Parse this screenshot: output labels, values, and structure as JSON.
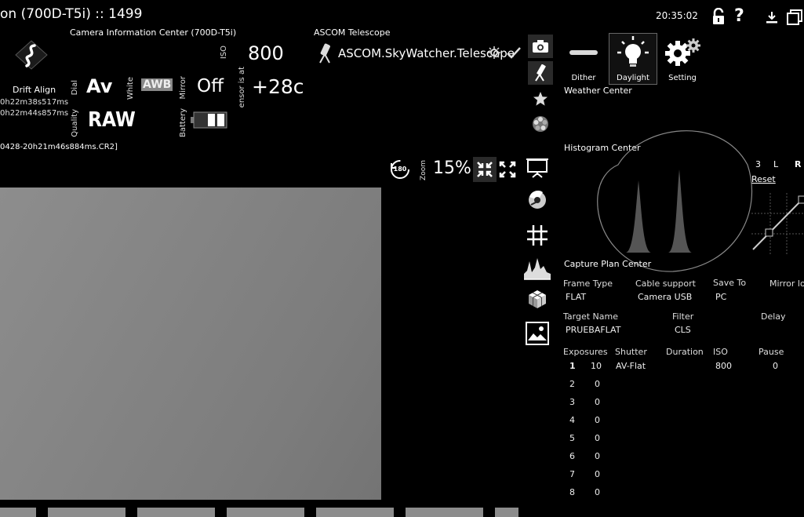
{
  "titlebar": {
    "title": "on (700D-T5i) :: 1499",
    "time": "20:35:02"
  },
  "camera_panel": {
    "title": "Camera Information Center (700D-T5i)",
    "drift_align": "Drift Align",
    "drift_times": [
      "0h22m38s517ms",
      "0h22m44s857ms"
    ],
    "dial_label": "Dial",
    "dial_value": "Av",
    "white_label": "White",
    "white_value": "AWB",
    "iso_label": "ISO",
    "iso_value": "800",
    "mirror_label": "Mirror",
    "mirror_value": "Off",
    "sensor_label": "ensor is at",
    "sensor_value": "+28c",
    "quality_label": "Quality",
    "quality_value": "RAW",
    "battery_label": "Battery",
    "filename": "0428-20h21m46s884ms.CR2]"
  },
  "telescope": {
    "title": "ASCOM Telescope",
    "driver": "ASCOM.SkyWatcher.Telescope"
  },
  "zoom": {
    "rotate_label": "180",
    "label": "Zoom",
    "value": "15%"
  },
  "modes": [
    {
      "label": "Dither",
      "icon": "dither-icon"
    },
    {
      "label": "Daylight",
      "icon": "lightbulb-icon"
    },
    {
      "label": "Setting",
      "icon": "gears-icon"
    }
  ],
  "weather": {
    "title": "Weather Center"
  },
  "histogram": {
    "title": "Histogram Center",
    "channels": [
      "3",
      "L",
      "R"
    ],
    "reset": "Reset"
  },
  "capture_plan": {
    "title": "Capture Plan Center",
    "frame_type_label": "Frame Type",
    "frame_type": "FLAT",
    "cable_label": "Cable support",
    "cable": "Camera USB",
    "save_to_label": "Save To",
    "save_to": "PC",
    "mirror_lock_label": "Mirror lo",
    "target_label": "Target Name",
    "target": "PRUEBAFLAT",
    "filter_label": "Filter",
    "filter": "CLS",
    "delay_label": "Delay",
    "columns": [
      "Exposures",
      "Shutter",
      "Duration",
      "ISO",
      "Pause"
    ],
    "rows": [
      {
        "n": "1",
        "exposures": "10",
        "shutter": "AV-Flat",
        "iso": "800",
        "pause": "0"
      },
      {
        "n": "2",
        "exposures": "0"
      },
      {
        "n": "3",
        "exposures": "0"
      },
      {
        "n": "4",
        "exposures": "0"
      },
      {
        "n": "5",
        "exposures": "0"
      },
      {
        "n": "6",
        "exposures": "0"
      },
      {
        "n": "7",
        "exposures": "0"
      },
      {
        "n": "8",
        "exposures": "0"
      }
    ]
  }
}
